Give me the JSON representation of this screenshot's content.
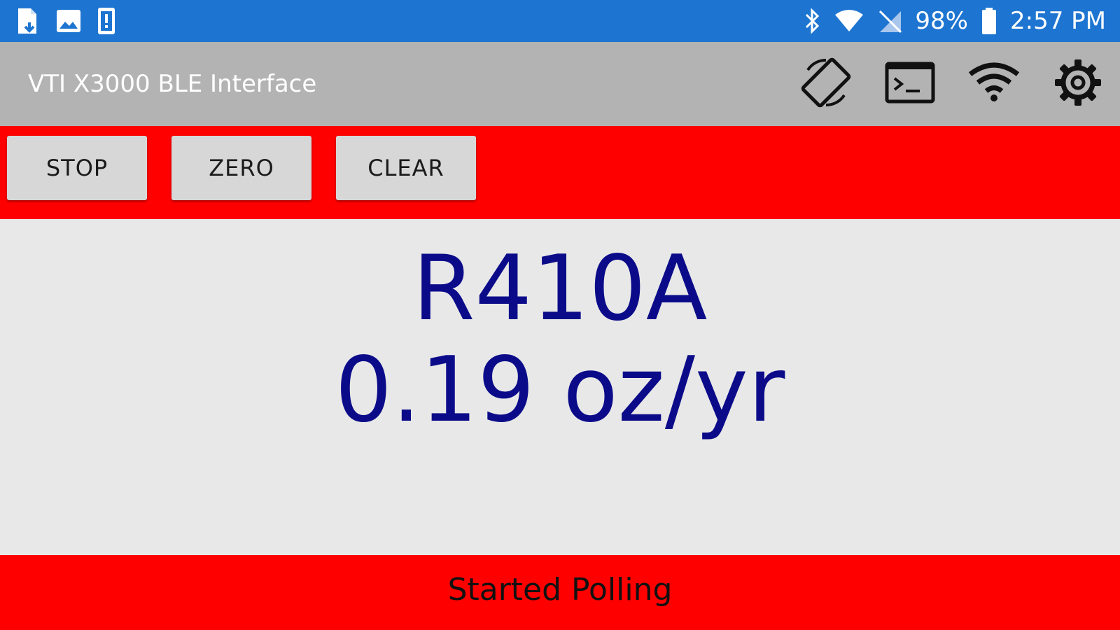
{
  "status_bar": {
    "left_icons": [
      "file-download-icon",
      "image-icon",
      "device-alert-icon"
    ],
    "battery": "98%",
    "time": "2:57 PM",
    "right_icons": [
      "bluetooth-icon",
      "wifi-signal-icon",
      "no-sim-icon",
      "battery-icon"
    ]
  },
  "app_bar": {
    "title": "VTI X3000 BLE Interface",
    "actions": [
      "screen-rotation-icon",
      "terminal-icon",
      "wifi-icon",
      "settings-gear-icon"
    ]
  },
  "toolbar": {
    "stop_label": "STOP",
    "zero_label": "ZERO",
    "clear_label": "CLEAR"
  },
  "main": {
    "refrigerant": "R410A",
    "leak_rate": "0.19 oz/yr"
  },
  "footer": {
    "status": "Started Polling"
  },
  "colors": {
    "status_bar": "#1e75d1",
    "app_bar": "#b3b3b3",
    "alarm_red": "#ff0000",
    "reading_text": "#0b0b8a",
    "main_background": "#e8e8e8"
  }
}
